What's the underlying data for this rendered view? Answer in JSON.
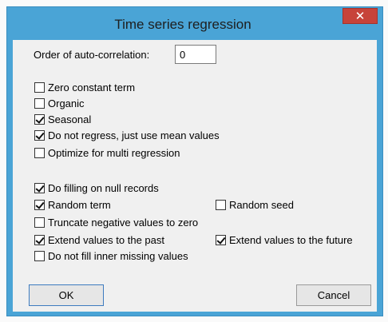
{
  "window": {
    "title": "Time series regression",
    "close_glyph": "✕"
  },
  "order": {
    "label": "Order of auto-correlation:",
    "value": "0"
  },
  "options": [
    {
      "label": "Zero constant term",
      "checked": false
    },
    {
      "label": "Organic",
      "checked": false
    },
    {
      "label": "Seasonal",
      "checked": true
    },
    {
      "label": "Do not regress, just use mean values",
      "checked": true
    },
    {
      "label": "Optimize for multi regression",
      "checked": false
    }
  ],
  "fill_options": {
    "do_filling": {
      "label": "Do filling on null records",
      "checked": true
    },
    "random_term": {
      "label": "Random term",
      "checked": true
    },
    "random_seed": {
      "label": "Random seed",
      "checked": false
    },
    "truncate_negative": {
      "label": "Truncate negative values to zero",
      "checked": false
    },
    "extend_past": {
      "label": "Extend values to the past",
      "checked": true
    },
    "extend_future": {
      "label": "Extend values to the future",
      "checked": true
    },
    "no_inner_fill": {
      "label": "Do not fill inner missing values",
      "checked": false
    }
  },
  "buttons": {
    "ok": "OK",
    "cancel": "Cancel"
  },
  "colors": {
    "frame": "#4aa4d6",
    "close": "#c7433a",
    "client": "#f0f0f0"
  }
}
